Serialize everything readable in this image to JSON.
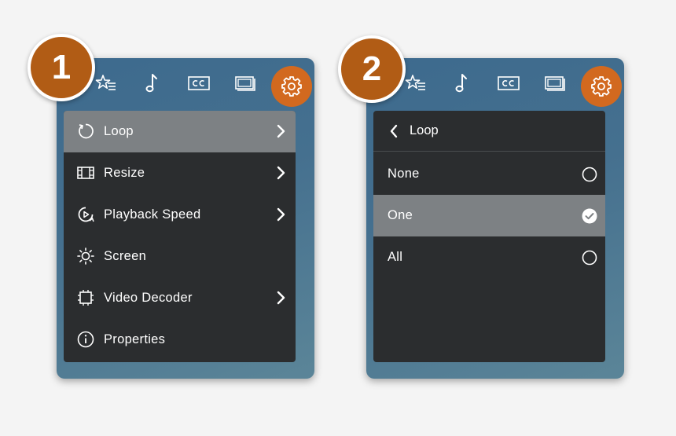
{
  "step_badges": [
    "1",
    "2"
  ],
  "colors": {
    "badge": "#b15c15",
    "settings_active": "#d2691f",
    "menu_bg": "#2b2d2f",
    "selected_row": "#7d8184",
    "panel_bg": "#45708f"
  },
  "toolbar": {
    "icons": [
      "favorites-icon",
      "music-note-icon",
      "closed-captions-icon",
      "picture-in-picture-icon",
      "gear-icon"
    ],
    "active": "gear-icon"
  },
  "settings_menu": {
    "items": [
      {
        "label": "Loop",
        "icon": "loop-icon",
        "has_submenu": true,
        "selected": true
      },
      {
        "label": "Resize",
        "icon": "resize-icon",
        "has_submenu": true,
        "selected": false
      },
      {
        "label": "Playback Speed",
        "icon": "playback-speed-icon",
        "has_submenu": true,
        "selected": false
      },
      {
        "label": "Screen",
        "icon": "brightness-icon",
        "has_submenu": false,
        "selected": false
      },
      {
        "label": "Video Decoder",
        "icon": "chip-icon",
        "has_submenu": true,
        "selected": false
      },
      {
        "label": "Properties",
        "icon": "info-icon",
        "has_submenu": false,
        "selected": false
      }
    ]
  },
  "loop_menu": {
    "title": "Loop",
    "options": [
      {
        "label": "None",
        "selected": false
      },
      {
        "label": "One",
        "selected": true
      },
      {
        "label": "All",
        "selected": false
      }
    ]
  }
}
